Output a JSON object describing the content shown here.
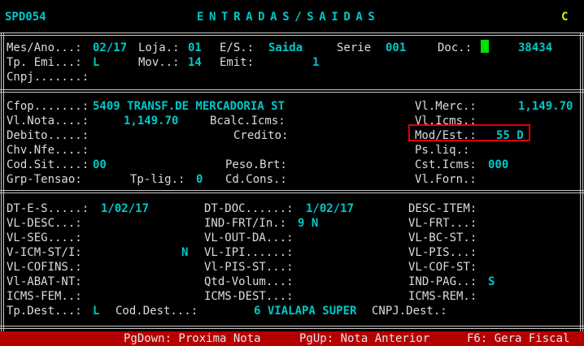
{
  "header": {
    "program": "SPD054",
    "title": "ENTRADAS/SAIDAS",
    "mode": "C"
  },
  "section1": {
    "mes_ano_label": "Mes/Ano...:",
    "mes_ano_value": "02/17",
    "loja_label": "Loja.:",
    "loja_value": "01",
    "es_label": "E/S.:",
    "es_value": "Saida",
    "serie_label": "Serie",
    "serie_value": "001",
    "doc_label": "Doc.:",
    "doc_value": "38434",
    "tp_emi_label": "Tp. Emi...:",
    "tp_emi_value": "L",
    "mov_label": "Mov..:",
    "mov_value": "14",
    "emit_label": "Emit:",
    "emit_value": "1",
    "cnpj_label": "Cnpj.......:"
  },
  "section2": {
    "cfop_label": "Cfop.......:",
    "cfop_value": "5409 TRANSF.DE MERCADORIA ST",
    "vl_merc_label": "Vl.Merc.:",
    "vl_merc_value": "1,149.70",
    "vl_nota_label": "Vl.Nota....:",
    "vl_nota_value": "1,149.70",
    "bcalc_icms_label": "Bcalc.Icms:",
    "vl_icms_label": "Vl.Icms.:",
    "debito_label": "Debito.....:",
    "credito_label": "Credito:",
    "mod_est_label": "Mod/Est.:",
    "mod_est_value": "55 D",
    "chv_nfe_label": "Chv.Nfe....:",
    "ps_liq_label": "Ps.liq.:",
    "cod_sit_label": "Cod.Sit....:",
    "cod_sit_value": "00",
    "peso_brt_label": "Peso.Brt:",
    "cst_icms_label": "Cst.Icms:",
    "cst_icms_value": "000",
    "grp_tensao_label": "Grp-Tensao:",
    "tp_lig_label": "Tp-lig.:",
    "tp_lig_value": "0",
    "cd_cons_label": "Cd.Cons.:",
    "vl_forn_label": "Vl.Forn.:"
  },
  "section3": {
    "dt_es_label": "DT-E-S.....:",
    "dt_es_value": "1/02/17",
    "dt_doc_label": "DT-DOC......:",
    "dt_doc_value": "1/02/17",
    "desc_item_label": "DESC-ITEM:",
    "vl_desc_label": "VL-DESC...:",
    "ind_frt_label": "IND-FRT/In.:",
    "ind_frt_value": "9 N",
    "vl_frt_label": "VL-FRT...:",
    "vl_seg_label": "VL-SEG....:",
    "vl_out_da_label": "VL-OUT-DA...:",
    "vl_bc_st_label": "VL-BC-ST.:",
    "v_icm_st_label": "V-ICM-ST/I:",
    "v_icm_st_value": "N",
    "vl_ipi_label": "VL-IPI......:",
    "vl_pis_label": "VL-PIS...:",
    "vl_cofins_label": "VL-COFINS.:",
    "vl_pis_st_label": "Vl-PIS-ST...:",
    "vl_cof_st_label": "VL-COF-ST:",
    "vl_abat_nt_label": "Vl-ABAT-NT:",
    "qtd_volum_label": "Qtd-Volum...:",
    "ind_pag_label": "IND-PAG..:",
    "ind_pag_value": "S",
    "icms_fem_label": "ICMS-FEM..:",
    "icms_dest_label": "ICMS-DEST...:",
    "icms_rem_label": "ICMS-REM.:",
    "tp_dest_label": "Tp.Dest...:",
    "tp_dest_value": "L",
    "cod_dest_label": "Cod.Dest...:",
    "cod_dest_value": "6 VIALAPA SUPER",
    "cnpj_dest_label": "CNPJ.Dest.:"
  },
  "status_bar": {
    "pgdown": "PgDown: Proxima Nota",
    "pgup": "PgUp: Nota Anterior",
    "f6": "F6: Gera Fiscal"
  },
  "colors": {
    "background": "#000000",
    "label": "#dcdcdc",
    "value": "#00c8c8",
    "mode": "#e6e600",
    "status_bar": "#b40000",
    "highlight_box": "#e00000",
    "cursor": "#00e000"
  }
}
